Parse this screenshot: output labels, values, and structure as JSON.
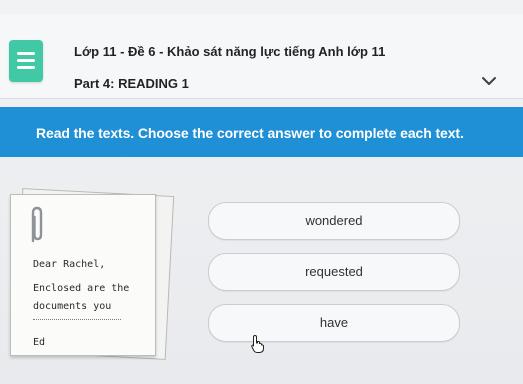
{
  "header": {
    "lesson_title": "Lớp 11 - Đề 6 - Khảo sát năng lực tiếng Anh lớp 11",
    "part_title": "Part 4: READING 1",
    "doc_icon": "document-lines-icon",
    "expand_icon": "chevron-down-icon"
  },
  "instruction": {
    "text": "Read the texts. Choose the correct answer to complete each text."
  },
  "note": {
    "greeting": "Dear Rachel,",
    "line1": "Enclosed are the",
    "line2": "documents you",
    "signature": "Ed",
    "paperclip_icon": "paperclip-icon"
  },
  "options": [
    {
      "label": "wondered"
    },
    {
      "label": "requested"
    },
    {
      "label": "have"
    }
  ],
  "cursor": {
    "icon": "hand-pointer-cursor-icon"
  },
  "colors": {
    "banner": "#1f8fd6",
    "doc_icon": "#41c9a5",
    "background": "#eceef1"
  }
}
